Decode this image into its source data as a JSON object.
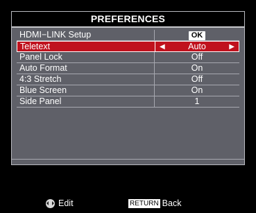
{
  "title": "PREFERENCES",
  "items": [
    {
      "label": "HDMI−LINK Setup",
      "value": "OK"
    },
    {
      "label": "Teletext",
      "value": "Auto"
    },
    {
      "label": "Panel Lock",
      "value": "Off"
    },
    {
      "label": "Auto Format",
      "value": "On"
    },
    {
      "label": "4:3 Stretch",
      "value": "Off"
    },
    {
      "label": "Blue Screen",
      "value": "On"
    },
    {
      "label": "Side Panel",
      "value": "1"
    }
  ],
  "footer": {
    "edit_label": "Edit",
    "return_key": "RETURN",
    "back_label": "Back"
  },
  "colors": {
    "panel": "#5f6068",
    "selected": "#c0121e",
    "title_bg": "#000000"
  },
  "icons": [
    "left-arrow-icon",
    "right-arrow-icon",
    "dpad-icon"
  ]
}
